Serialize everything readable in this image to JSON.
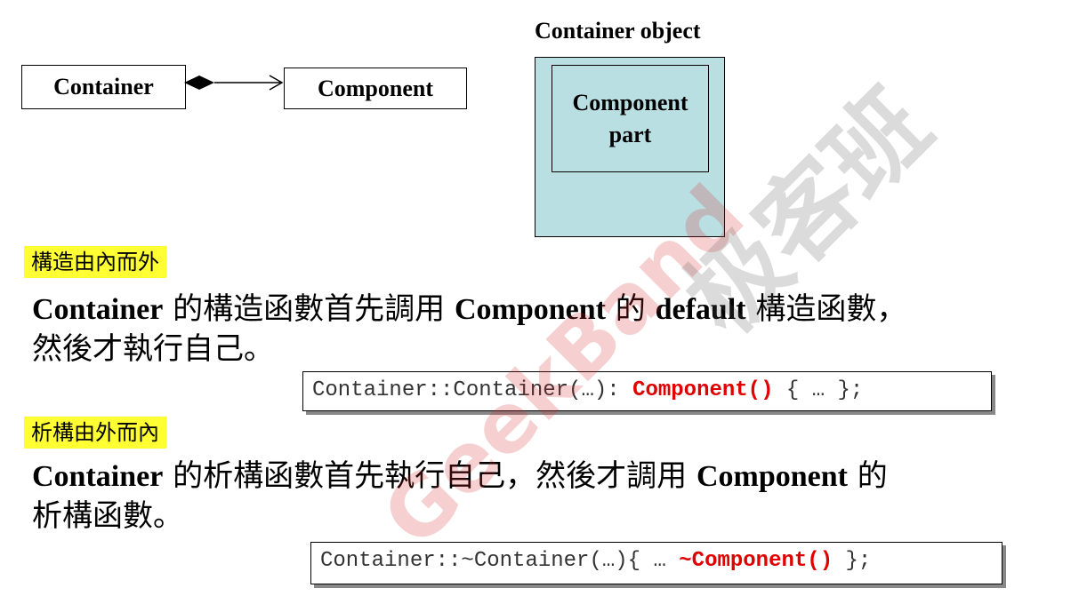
{
  "diagram": {
    "container_label": "Container",
    "component_label": "Component",
    "object_title": "Container object",
    "object_part_line1": "Component",
    "object_part_line2": "part"
  },
  "constructor": {
    "tag": "構造由內而外",
    "word_container": "Container",
    "text1": " 的構造函數首先調用 ",
    "word_component": "Component",
    "text2": " 的 ",
    "word_default": "default",
    "text3": " 構造函數，",
    "text4": "然後才執行自己。",
    "code_prefix": "Container::Container(…): ",
    "code_highlight": "Component()",
    "code_suffix": " { … };"
  },
  "destructor": {
    "tag": "析構由外而內",
    "word_container": "Container",
    "text1": " 的析構函數首先執行自己，然後才調用 ",
    "word_component": "Component",
    "text2": " 的",
    "text3": "析構函數。",
    "code_prefix": "Container::~Container(…){ … ",
    "code_highlight": "~Component()",
    "code_suffix": " };"
  },
  "watermark": {
    "brand_en": "GeekBand",
    "brand_cn": "极客班"
  }
}
